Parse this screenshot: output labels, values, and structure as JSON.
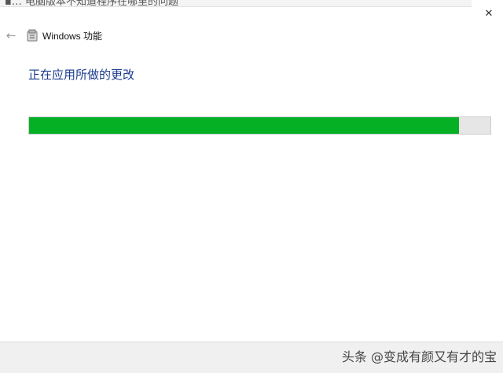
{
  "top_strip": {
    "text": "▪… 电脑版本不知道程序在哪里的问题"
  },
  "window": {
    "title": "Windows 功能",
    "close_glyph": "✕",
    "back_glyph": "←",
    "icons": {
      "back": "arrow-left-icon",
      "app": "windows-features-icon",
      "close": "close-icon"
    }
  },
  "main": {
    "heading": "正在应用所做的更改",
    "progress_fraction": 0.932,
    "progress_color": "#06b025"
  },
  "watermark": {
    "text": "头条 @变成有颜又有才的宝"
  },
  "colors": {
    "heading": "#1a3a8c",
    "track": "#e6e6e6",
    "footer": "#f0f0f0"
  }
}
